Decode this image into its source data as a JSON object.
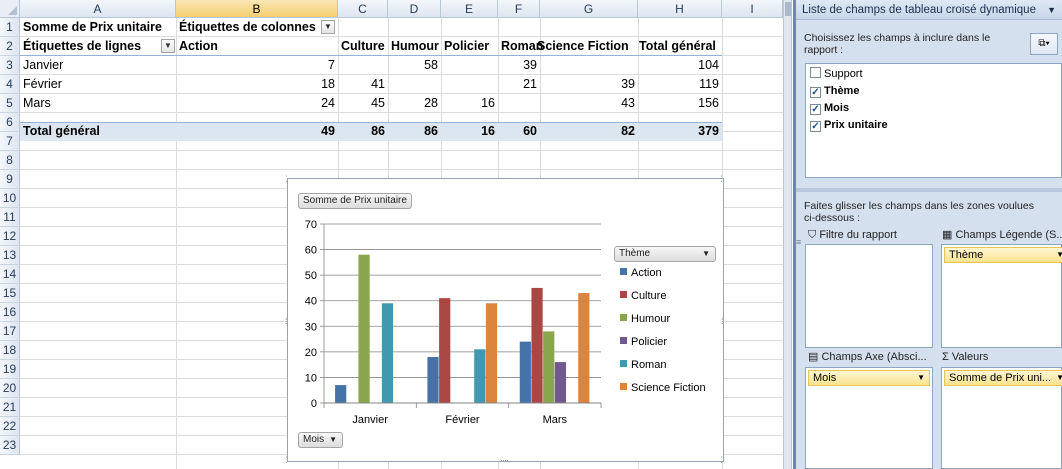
{
  "spreadsheet": {
    "columns": [
      "A",
      "B",
      "C",
      "D",
      "E",
      "F",
      "G",
      "H",
      "I"
    ],
    "rows": [
      "1",
      "2",
      "3",
      "4",
      "5",
      "6",
      "7",
      "8",
      "9",
      "10",
      "11",
      "12",
      "13",
      "14",
      "15",
      "16",
      "17",
      "18",
      "19",
      "20",
      "21",
      "22",
      "23"
    ],
    "pivot": {
      "value_label": "Somme de Prix unitaire",
      "col_labels_title": "Étiquettes de colonnes",
      "row_labels_title": "Étiquettes de lignes",
      "column_headers": [
        "Action",
        "Culture",
        "Humour",
        "Policier",
        "Roman",
        "Science Fiction",
        "Total général"
      ],
      "data_rows": [
        {
          "label": "Janvier",
          "values": [
            "7",
            "",
            "58",
            "",
            "39",
            "",
            "104"
          ]
        },
        {
          "label": "Février",
          "values": [
            "18",
            "41",
            "",
            "",
            "21",
            "39",
            "119"
          ]
        },
        {
          "label": "Mars",
          "values": [
            "24",
            "45",
            "28",
            "16",
            "",
            "43",
            "156"
          ]
        }
      ],
      "total_row": {
        "label": "Total général",
        "values": [
          "49",
          "86",
          "86",
          "16",
          "60",
          "82",
          "379"
        ]
      }
    }
  },
  "chart": {
    "value_field_button": "Somme de Prix unitaire",
    "legend_field_button": "Thème",
    "axis_field_button": "Mois"
  },
  "chart_data": {
    "type": "bar",
    "title": "",
    "categories": [
      "Janvier",
      "Février",
      "Mars"
    ],
    "series": [
      {
        "name": "Action",
        "color": "#4572a7",
        "values": [
          7,
          18,
          24
        ]
      },
      {
        "name": "Culture",
        "color": "#aa4643",
        "values": [
          null,
          41,
          45
        ]
      },
      {
        "name": "Humour",
        "color": "#89a54e",
        "values": [
          58,
          null,
          28
        ]
      },
      {
        "name": "Policier",
        "color": "#71588f",
        "values": [
          null,
          null,
          16
        ]
      },
      {
        "name": "Roman",
        "color": "#4198af",
        "values": [
          39,
          21,
          null
        ]
      },
      {
        "name": "Science Fiction",
        "color": "#db843d",
        "values": [
          null,
          39,
          43
        ]
      }
    ],
    "ylim": [
      0,
      70
    ],
    "yticks": [
      "0",
      "10",
      "20",
      "30",
      "40",
      "50",
      "60",
      "70"
    ],
    "grid": true,
    "legend_position": "right"
  },
  "pane": {
    "title": "Liste de champs de tableau croisé dynamique",
    "choose_text_1": "Choisissez les champs à inclure dans le",
    "choose_text_2": "rapport :",
    "fields": [
      {
        "label": "Support",
        "checked": false
      },
      {
        "label": "Thème",
        "checked": true
      },
      {
        "label": "Mois",
        "checked": true
      },
      {
        "label": "Prix unitaire",
        "checked": true
      }
    ],
    "drag_text_1": "Faites glisser les champs dans les zones voulues",
    "drag_text_2": "ci-dessous :",
    "zones": {
      "report_filter": "Filtre du rapport",
      "legend_fields": "Champs Légende (S...",
      "axis_fields": "Champs Axe (Absci...",
      "values": "Valeurs"
    },
    "zone_items": {
      "legend": "Thème",
      "axis": "Mois",
      "values": "Somme de Prix uni..."
    }
  }
}
